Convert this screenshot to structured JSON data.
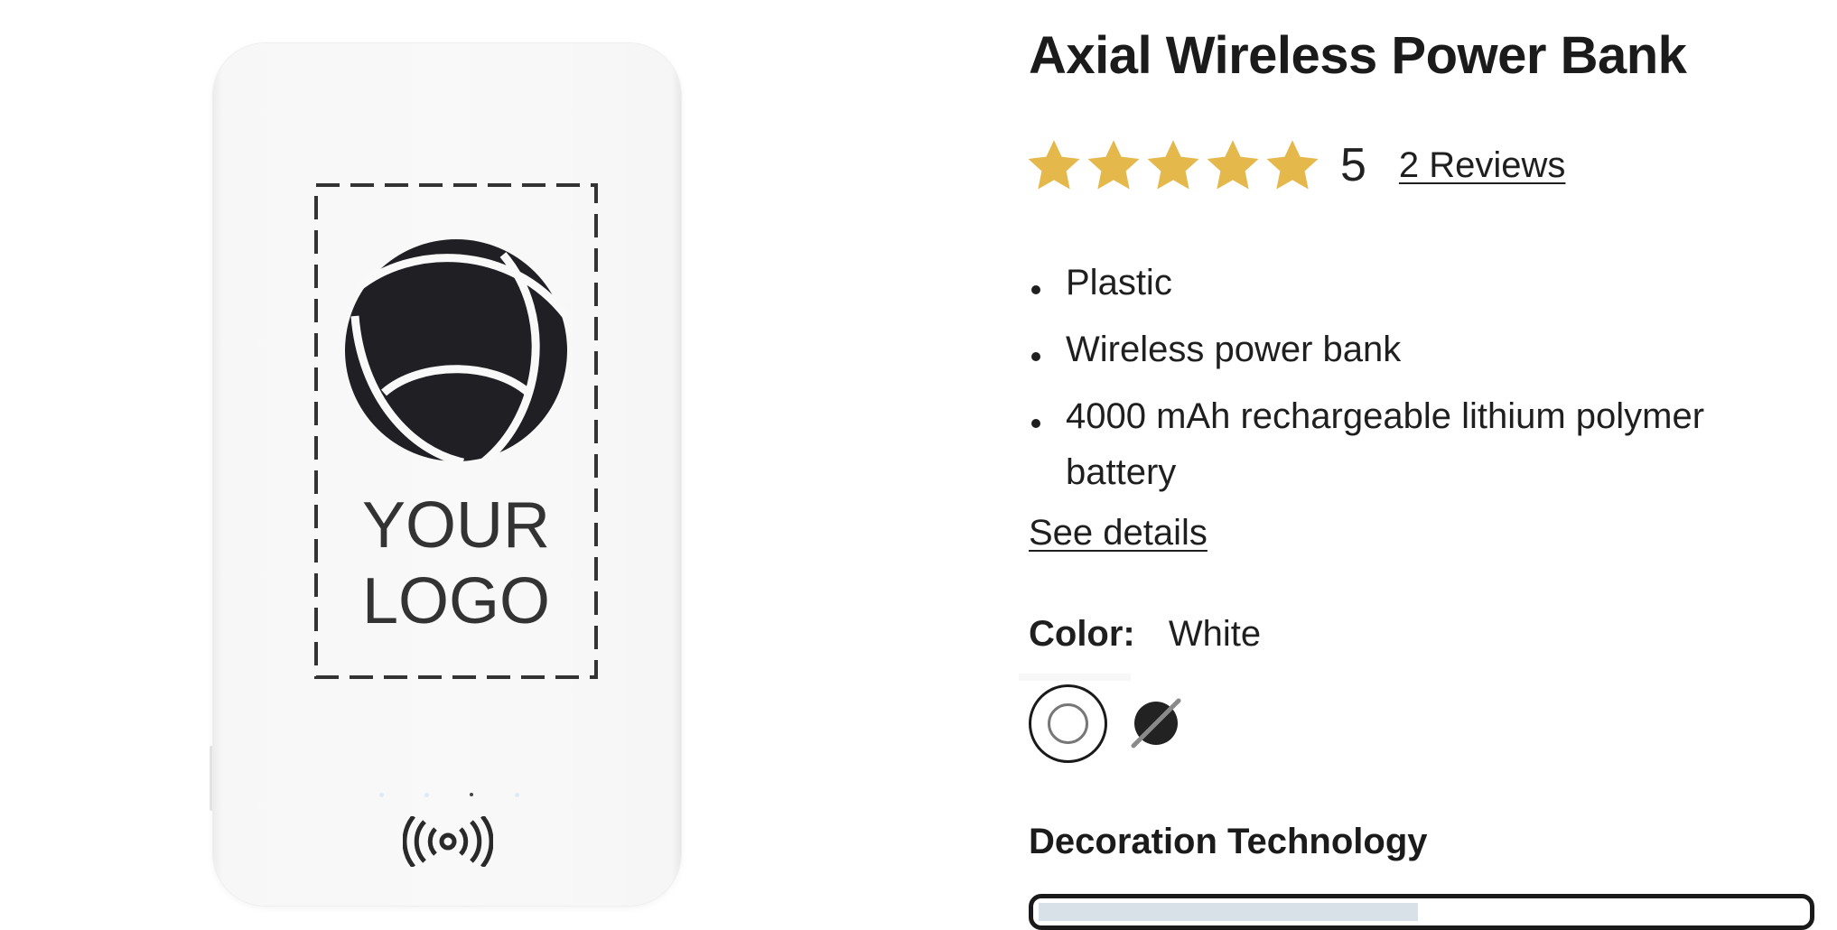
{
  "product": {
    "title": "Axial Wireless Power Bank",
    "image_logo_text": [
      "YOUR",
      "LOGO"
    ]
  },
  "rating": {
    "stars_filled": 5,
    "stars_total": 5,
    "value": "5",
    "reviews_label": "2 Reviews",
    "star_color": "#e5b84c"
  },
  "features": [
    "Plastic",
    "Wireless power bank",
    "4000 mAh rechargeable lithium polymer battery"
  ],
  "see_details_label": "See details",
  "color": {
    "label": "Color:",
    "selected_value": "White",
    "options": [
      {
        "name": "White",
        "hex": "#ffffff",
        "selected": true,
        "available": true
      },
      {
        "name": "Black",
        "hex": "#222222",
        "selected": false,
        "available": false
      }
    ]
  },
  "decoration": {
    "heading": "Decoration Technology"
  },
  "icons": [
    "star-icon",
    "wireless-charging-icon",
    "logo-placeholder-icon",
    "unavailable-slash-icon"
  ]
}
